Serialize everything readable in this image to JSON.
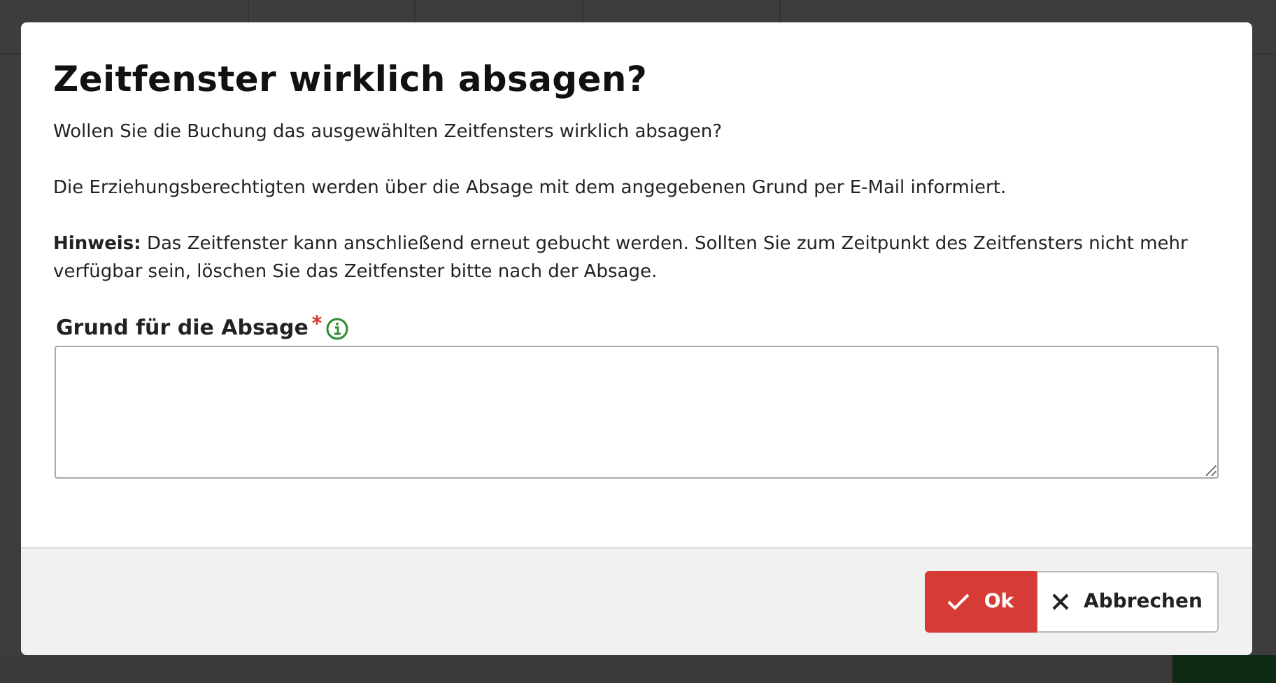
{
  "dialog": {
    "title": "Zeitfenster wirklich absagen?",
    "paragraphs": [
      "Wollen Sie die Buchung das ausgewählten Zeitfensters wirklich absagen?",
      "Die Erziehungsberechtigten werden über die Absage mit dem angegebenen Grund per E-Mail informiert.",
      "**Hinweis:** Das Zeitfenster kann anschließend erneut gebucht werden. Sollten Sie zum Zeitpunkt des Zeitfensters nicht mehr verfügbar sein, löschen Sie das Zeitfenster bitte nach der Absage."
    ],
    "field": {
      "label": "Grund für die Absage",
      "required": true
    },
    "buttons": [
      {
        "label": "Ok",
        "kind": "confirm"
      },
      {
        "label": "Abbrechen",
        "kind": "cancel"
      }
    ]
  }
}
